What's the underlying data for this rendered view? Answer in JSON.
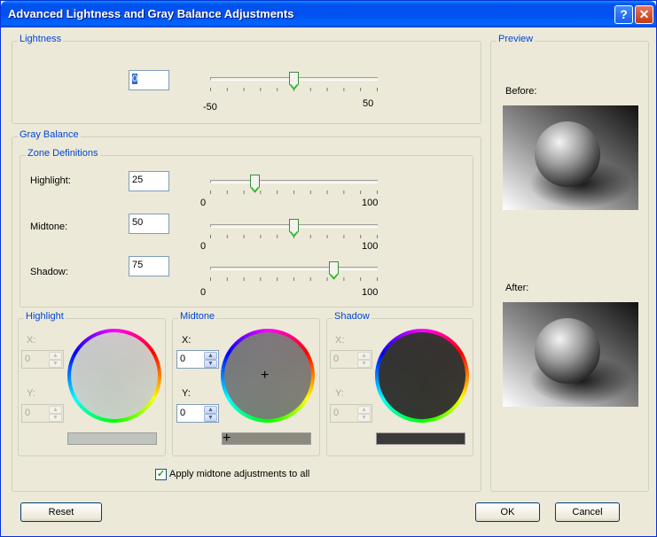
{
  "window": {
    "title": "Advanced Lightness and Gray Balance Adjustments",
    "help_glyph": "?",
    "close_glyph": "✕"
  },
  "lightness": {
    "legend": "Lightness",
    "value": "0",
    "min_label": "-50",
    "max_label": "50",
    "level": 0.5
  },
  "gray_balance": {
    "legend": "Gray Balance",
    "zones_legend": "Zone Definitions",
    "highlight": {
      "label": "Highlight:",
      "value": "25",
      "min_label": "0",
      "max_label": "100",
      "level": 0.25
    },
    "midtone": {
      "label": "Midtone:",
      "value": "50",
      "min_label": "0",
      "max_label": "100",
      "level": 0.5
    },
    "shadow": {
      "label": "Shadow:",
      "value": "75",
      "min_label": "0",
      "max_label": "100",
      "level": 0.75
    }
  },
  "wheels": {
    "highlight": {
      "legend": "Highlight",
      "x_label": "X:",
      "x_value": "0",
      "y_label": "Y:",
      "y_value": "0",
      "enabled": false,
      "swatch_color": "#bfc4be"
    },
    "midtone": {
      "legend": "Midtone",
      "x_label": "X:",
      "x_value": "0",
      "y_label": "Y:",
      "y_value": "0",
      "enabled": true,
      "swatch_color": "#8a8a80"
    },
    "shadow": {
      "legend": "Shadow",
      "x_label": "X:",
      "x_value": "0",
      "y_label": "Y:",
      "y_value": "0",
      "enabled": false,
      "swatch_color": "#3a3a38"
    }
  },
  "apply_all": {
    "label": "Apply midtone adjustments to all",
    "checked": true
  },
  "preview": {
    "legend": "Preview",
    "before_label": "Before:",
    "after_label": "After:"
  },
  "buttons": {
    "reset": "Reset",
    "ok": "OK",
    "cancel": "Cancel"
  },
  "colors": {
    "legend_blue": "#0046d5",
    "title_blue": "#0053ee",
    "close_red": "#c13b14"
  }
}
